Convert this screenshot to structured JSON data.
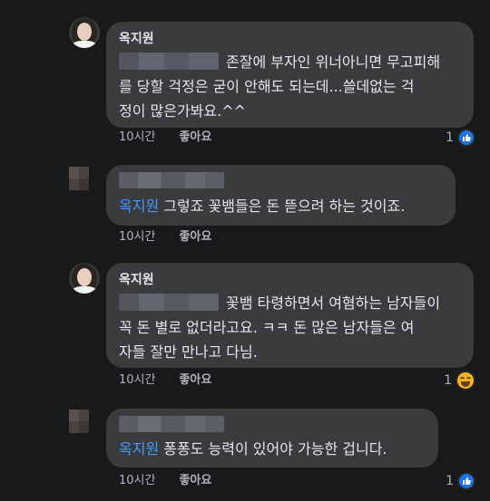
{
  "comments": [
    {
      "author": "옥지원",
      "text_lines": [
        "존잘에 부자인 위너아니면 무고피해",
        "를 당할 걱정은 굳이 안해도 되는데...쓸데없는 걱",
        "정이 많은가봐요.^^"
      ],
      "time": "10시간",
      "like_label": "좋아요",
      "reaction_count": "1",
      "reaction": "like-icon"
    },
    {
      "author": "",
      "mention": "옥지원",
      "text": "그렇죠 꽃뱀들은 돈 뜯으려 하는 것이죠.",
      "time": "10시간",
      "like_label": "좋아요"
    },
    {
      "author": "옥지원",
      "text_lines": [
        "꽃뱀 타령하면서 여혐하는 남자들이",
        "꼭 돈 별로 없더라고요. ㅋㅋ 돈 많은 남자들은 여",
        "자들 잘만 만나고 다님."
      ],
      "time": "10시간",
      "like_label": "좋아요",
      "reaction_count": "1",
      "reaction": "haha-icon"
    },
    {
      "author": "",
      "mention": "옥지원",
      "text": "퐁퐁도 능력이 있어야 가능한 겁니다.",
      "time": "10시간",
      "like_label": "좋아요",
      "reaction_count": "1",
      "reaction": "like-icon"
    }
  ],
  "colors": {
    "background": "#18191a",
    "bubble": "#3a3b3c",
    "text": "#e4e6eb",
    "meta": "#b0b3b8",
    "mention": "#4599ff",
    "like": "#1b74e4",
    "haha": "#f7b125"
  }
}
